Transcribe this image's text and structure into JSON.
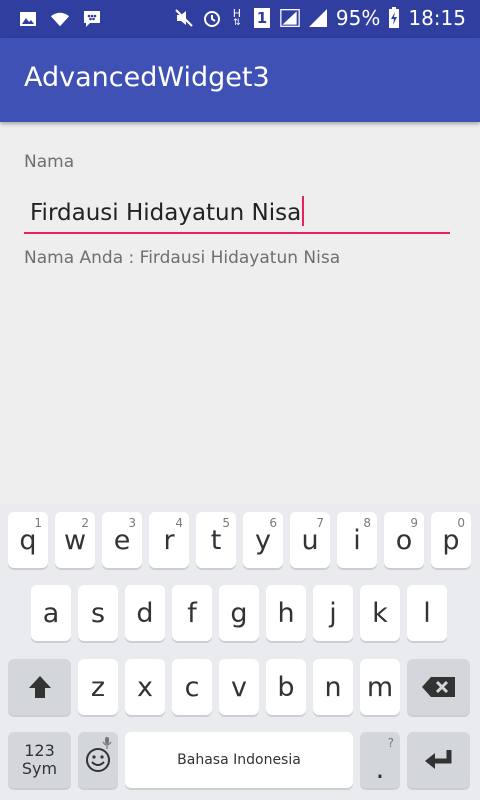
{
  "status_bar": {
    "battery_percent": "95%",
    "time": "18:15",
    "h_indicator": "H",
    "sim_indicator": "1",
    "icons": [
      "gallery-icon",
      "wifi-icon",
      "bbm-icon",
      "mute-icon",
      "alarm-icon",
      "network-h-icon",
      "sim-1-icon",
      "signal-1-icon",
      "signal-2-icon",
      "battery-charging-icon"
    ]
  },
  "app_bar": {
    "title": "AdvancedWidget3"
  },
  "form": {
    "label": "Nama",
    "input_value": "Firdausi Hidayatun Nisa",
    "result_text": "Nama Anda : Firdausi Hidayatun Nisa"
  },
  "keyboard": {
    "row1": [
      {
        "key": "q",
        "hint": "1"
      },
      {
        "key": "w",
        "hint": "2"
      },
      {
        "key": "e",
        "hint": "3"
      },
      {
        "key": "r",
        "hint": "4"
      },
      {
        "key": "t",
        "hint": "5"
      },
      {
        "key": "y",
        "hint": "6"
      },
      {
        "key": "u",
        "hint": "7"
      },
      {
        "key": "i",
        "hint": "8"
      },
      {
        "key": "o",
        "hint": "9"
      },
      {
        "key": "p",
        "hint": "0"
      }
    ],
    "row2": [
      "a",
      "s",
      "d",
      "f",
      "g",
      "h",
      "j",
      "k",
      "l"
    ],
    "row3": [
      "z",
      "x",
      "c",
      "v",
      "b",
      "n",
      "m"
    ],
    "sym_label_top": "123",
    "sym_label_bottom": "Sym",
    "space_label": "Bahasa Indonesia",
    "period_key": ".",
    "period_hint": "?",
    "accent_color": "#e91e63"
  },
  "colors": {
    "status_bar": "#303f9f",
    "app_bar": "#3f51b5",
    "background": "#eeeeee"
  }
}
